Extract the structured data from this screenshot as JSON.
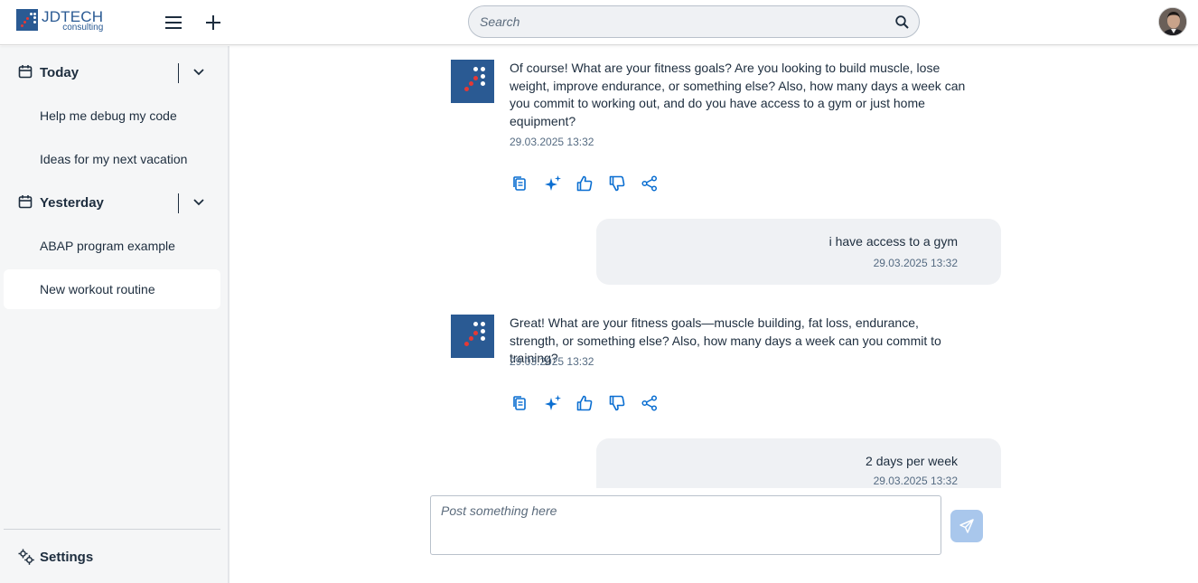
{
  "header": {
    "logo_title": "JDTECH",
    "logo_subtitle": "consulting",
    "menu_icon": "hamburger-icon",
    "new_chat_icon": "plus-icon",
    "search_placeholder": "Search",
    "search_icon": "search-icon"
  },
  "sidebar": {
    "groups": [
      {
        "title": "Today",
        "items": [
          "Help me debug my code",
          "Ideas for my next vacation"
        ]
      },
      {
        "title": "Yesterday",
        "items": [
          "ABAP program example",
          "New workout routine"
        ]
      }
    ],
    "active_item": "New workout routine",
    "settings_label": "Settings"
  },
  "messages": [
    {
      "role": "assistant",
      "text": "Of course! What are your fitness goals? Are you looking to build muscle, lose weight, improve endurance, or something else? Also, how many days a week can you commit to working out, and do you have access to a gym or just home equipment?",
      "timestamp": "29.03.2025 13:32"
    },
    {
      "role": "user",
      "text": "i have access to a gym",
      "timestamp": "29.03.2025 13:32"
    },
    {
      "role": "assistant",
      "text": "Great! What are your fitness goals—muscle building, fat loss, endurance, strength, or something else? Also, how many days a week can you commit to training?",
      "timestamp": "29.03.2025 13:32"
    },
    {
      "role": "user",
      "text": "2 days per week",
      "timestamp": "29.03.2025 13:32"
    }
  ],
  "message_actions": [
    "copy-icon",
    "ai-sparkle-icon",
    "thumbs-up-icon",
    "thumbs-down-icon",
    "share-icon"
  ],
  "composer": {
    "placeholder": "Post something here",
    "send_icon": "send-icon"
  },
  "colors": {
    "brand": "#2a5a93",
    "accent_dot": "#e53935",
    "action_icon": "#0a6ed1",
    "send_button": "#a9c7ec",
    "user_bubble": "#eff1f4",
    "sidebar_bg": "#f5f6f7"
  }
}
